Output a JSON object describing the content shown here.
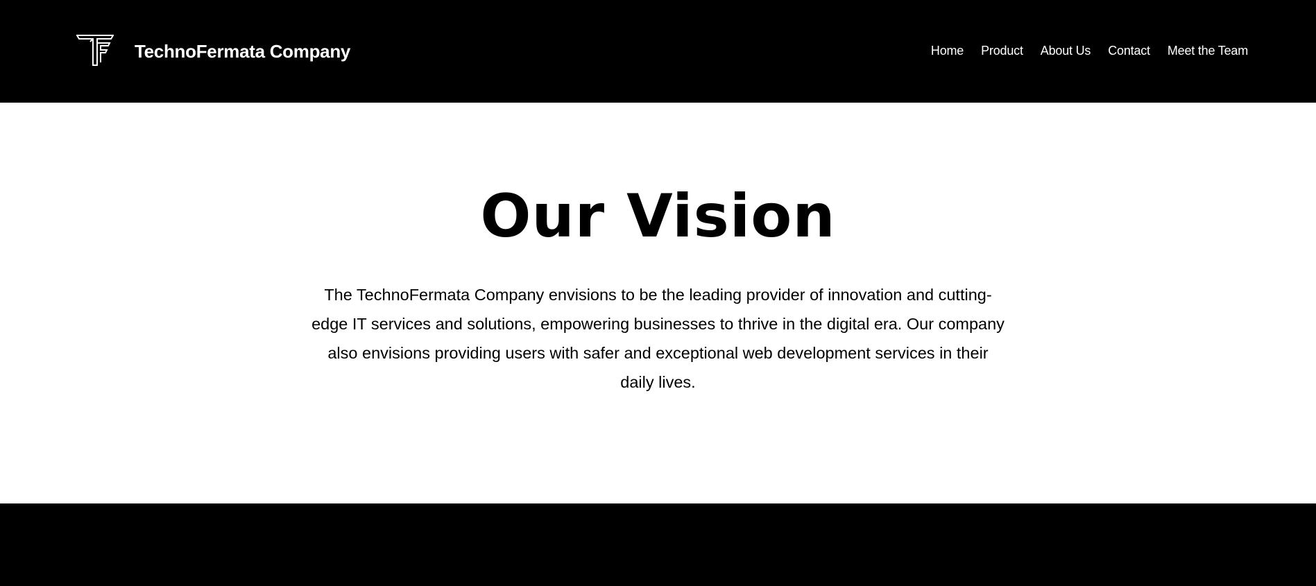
{
  "header": {
    "logo_icon": "tf-monogram-logo",
    "brand": "TechnoFermata Company",
    "nav": [
      {
        "label": "Home"
      },
      {
        "label": "Product"
      },
      {
        "label": "About Us"
      },
      {
        "label": "Contact"
      },
      {
        "label": "Meet the Team"
      }
    ]
  },
  "vision": {
    "title": "Our Vision",
    "text": "The TechnoFermata Company envisions to be the leading provider of innovation and cutting-edge IT services and solutions, empowering businesses to thrive in the digital era. Our company also envisions providing users with safer and exceptional web development services in their daily lives."
  },
  "colors": {
    "header_bg": "#000000",
    "page_bg": "#ffffff",
    "footer_bg": "#000000",
    "text_light": "#ffffff",
    "text_dark": "#000000"
  }
}
